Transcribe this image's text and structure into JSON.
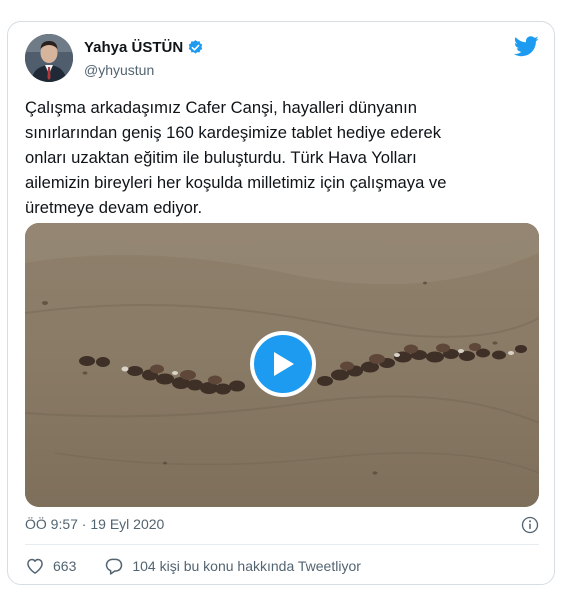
{
  "author": {
    "display_name": "Yahya ÜSTÜN",
    "handle": "@yhyustun",
    "verified_icon": "verified-badge-icon",
    "avatar_icon": "profile-avatar"
  },
  "platform_icon": "twitter-bird-icon",
  "tweet": {
    "text": "Çalışma arkadaşımız Cafer Canşi, hayalleri dünyanın\nsınırlarından geniş 160 kardeşimize tablet hediye ederek\nonları uzaktan eğitim ile buluşturdu. Türk Hava Yolları\nailemizin bireyleri her koşulda milletimiz için çalışmaya ve\nüretmeye devam ediyor."
  },
  "media": {
    "type": "video",
    "play_icon": "play-icon"
  },
  "meta": {
    "timestamp": "ÖÖ 9:57 · 19 Eyl 2020",
    "info_icon": "info-icon"
  },
  "engagement": {
    "like_count": "663",
    "reply_text": "104 kişi bu konu hakkında Tweetliyor"
  },
  "colors": {
    "accent": "#1d9bf0",
    "text_primary": "#0f1419",
    "text_secondary": "#536471",
    "border": "#d6dde3"
  }
}
